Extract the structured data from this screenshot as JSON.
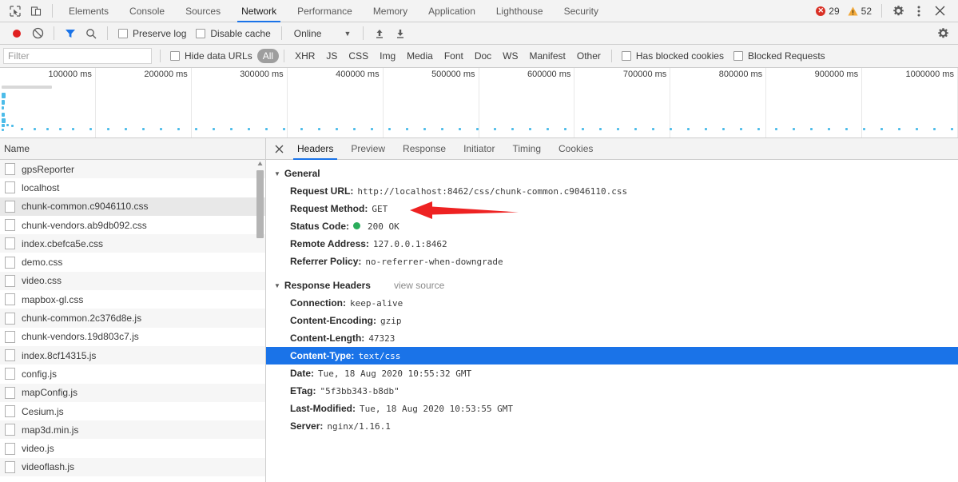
{
  "devtools": {
    "main_tabs": [
      {
        "label": "Elements",
        "active": false
      },
      {
        "label": "Console",
        "active": false
      },
      {
        "label": "Sources",
        "active": false
      },
      {
        "label": "Network",
        "active": true
      },
      {
        "label": "Performance",
        "active": false
      },
      {
        "label": "Memory",
        "active": false
      },
      {
        "label": "Application",
        "active": false
      },
      {
        "label": "Lighthouse",
        "active": false
      },
      {
        "label": "Security",
        "active": false
      }
    ],
    "icons": {
      "inspect": "inspect-element-icon",
      "device": "device-toolbar-icon",
      "gear": "settings-gear-icon",
      "kebab": "more-options-icon",
      "close": "close-devtools-icon"
    },
    "counters": {
      "error_count": "29",
      "warning_count": "52",
      "error_color": "#d93025",
      "warning_color": "#f2a93b"
    }
  },
  "toolbar": {
    "record_label": "record-button",
    "clear_label": "clear-button",
    "filter_label": "filter-button",
    "search_label": "search-button",
    "preserve_log": "Preserve log",
    "disable_cache": "Disable cache",
    "throttling": "Online",
    "import_label": "import-har-button",
    "export_label": "export-har-button",
    "accent_color": "#1a73e8"
  },
  "filterbar": {
    "placeholder": "Filter",
    "value": "",
    "hide_data_urls": "Hide data URLs",
    "types": [
      {
        "label": "All",
        "selected": true
      },
      {
        "label": "XHR",
        "selected": false
      },
      {
        "label": "JS",
        "selected": false
      },
      {
        "label": "CSS",
        "selected": false
      },
      {
        "label": "Img",
        "selected": false
      },
      {
        "label": "Media",
        "selected": false
      },
      {
        "label": "Font",
        "selected": false
      },
      {
        "label": "Doc",
        "selected": false
      },
      {
        "label": "WS",
        "selected": false
      },
      {
        "label": "Manifest",
        "selected": false
      },
      {
        "label": "Other",
        "selected": false
      }
    ],
    "has_blocked_cookies": "Has blocked cookies",
    "blocked_requests": "Blocked Requests"
  },
  "overview": {
    "ticks": [
      "100000 ms",
      "200000 ms",
      "300000 ms",
      "400000 ms",
      "500000 ms",
      "600000 ms",
      "700000 ms",
      "800000 ms",
      "900000 ms",
      "1000000 ms"
    ],
    "bar_color": "#d8d8d8",
    "dot_color": "#4dbce9"
  },
  "requests": {
    "column_header": "Name",
    "rows": [
      {
        "name": "gpsReporter",
        "selected": false
      },
      {
        "name": "localhost",
        "selected": false
      },
      {
        "name": "chunk-common.c9046110.css",
        "selected": true
      },
      {
        "name": "chunk-vendors.ab9db092.css",
        "selected": false
      },
      {
        "name": "index.cbefca5e.css",
        "selected": false
      },
      {
        "name": "demo.css",
        "selected": false
      },
      {
        "name": "video.css",
        "selected": false
      },
      {
        "name": "mapbox-gl.css",
        "selected": false
      },
      {
        "name": "chunk-common.2c376d8e.js",
        "selected": false
      },
      {
        "name": "chunk-vendors.19d803c7.js",
        "selected": false
      },
      {
        "name": "index.8cf14315.js",
        "selected": false
      },
      {
        "name": "config.js",
        "selected": false
      },
      {
        "name": "mapConfig.js",
        "selected": false
      },
      {
        "name": "Cesium.js",
        "selected": false
      },
      {
        "name": "map3d.min.js",
        "selected": false
      },
      {
        "name": "video.js",
        "selected": false
      },
      {
        "name": "videoflash.js",
        "selected": false
      }
    ]
  },
  "detail": {
    "tabs": [
      {
        "label": "Headers",
        "active": true
      },
      {
        "label": "Preview",
        "active": false
      },
      {
        "label": "Response",
        "active": false
      },
      {
        "label": "Initiator",
        "active": false
      },
      {
        "label": "Timing",
        "active": false
      },
      {
        "label": "Cookies",
        "active": false
      }
    ],
    "general": {
      "title": "General",
      "rows": [
        {
          "key": "Request URL:",
          "value": "http://localhost:8462/css/chunk-common.c9046110.css",
          "status": false,
          "selected": false
        },
        {
          "key": "Request Method:",
          "value": "GET",
          "status": false,
          "selected": false
        },
        {
          "key": "Status Code:",
          "value": "200 OK",
          "status": true,
          "selected": false
        },
        {
          "key": "Remote Address:",
          "value": "127.0.0.1:8462",
          "status": false,
          "selected": false
        },
        {
          "key": "Referrer Policy:",
          "value": "no-referrer-when-downgrade",
          "status": false,
          "selected": false
        }
      ]
    },
    "response_headers": {
      "title": "Response Headers",
      "view_source": "view source",
      "rows": [
        {
          "key": "Connection:",
          "value": "keep-alive",
          "status": false,
          "selected": false
        },
        {
          "key": "Content-Encoding:",
          "value": "gzip",
          "status": false,
          "selected": false
        },
        {
          "key": "Content-Length:",
          "value": "47323",
          "status": false,
          "selected": false
        },
        {
          "key": "Content-Type:",
          "value": "text/css",
          "status": false,
          "selected": true
        },
        {
          "key": "Date:",
          "value": "Tue, 18 Aug 2020 10:55:32 GMT",
          "status": false,
          "selected": false
        },
        {
          "key": "ETag:",
          "value": "\"5f3bb343-b8db\"",
          "status": false,
          "selected": false
        },
        {
          "key": "Last-Modified:",
          "value": "Tue, 18 Aug 2020 10:53:55 GMT",
          "status": false,
          "selected": false
        },
        {
          "key": "Server:",
          "value": "nginx/1.16.1",
          "status": false,
          "selected": false
        }
      ]
    },
    "selection_color": "#1a73e8",
    "status_ok_color": "#2aad5b"
  },
  "annotation": {
    "type": "arrow",
    "points_to": "gzip",
    "color": "#ee2222"
  }
}
